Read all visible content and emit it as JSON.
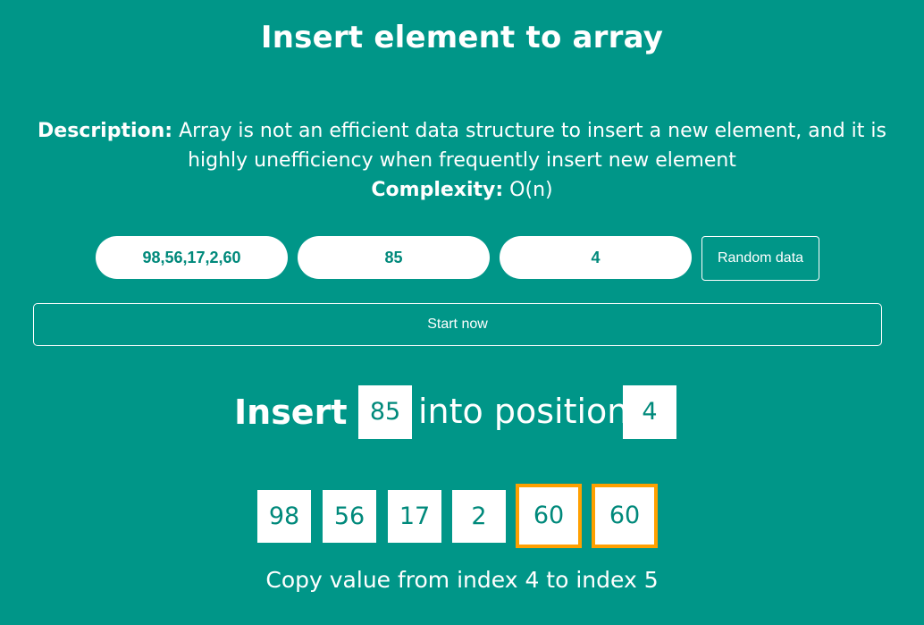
{
  "header": {
    "title": "Insert element to array"
  },
  "description": {
    "label": "Description:",
    "text": "Array is not an efficient data structure to insert a new element, and it is highly unefficiency when frequently insert new element",
    "complexity_label": "Complexity:",
    "complexity_value": "O(n)"
  },
  "controls": {
    "array_input_value": "98,56,17,2,60",
    "value_input_value": "85",
    "position_input_value": "4",
    "random_button_label": "Random data",
    "start_button_label": "Start now"
  },
  "visual": {
    "insert_label": "Insert",
    "insert_value": "85",
    "into_label": "into position",
    "insert_position": "4",
    "array": [
      "98",
      "56",
      "17",
      "2",
      "60",
      "60"
    ],
    "highlighted_indices": [
      4,
      5
    ],
    "highlight_color": "#ffa000"
  },
  "status": {
    "message": "Copy value from index 4 to index 5"
  },
  "theme": {
    "background": "#009688",
    "accent_text": "#00897b"
  }
}
